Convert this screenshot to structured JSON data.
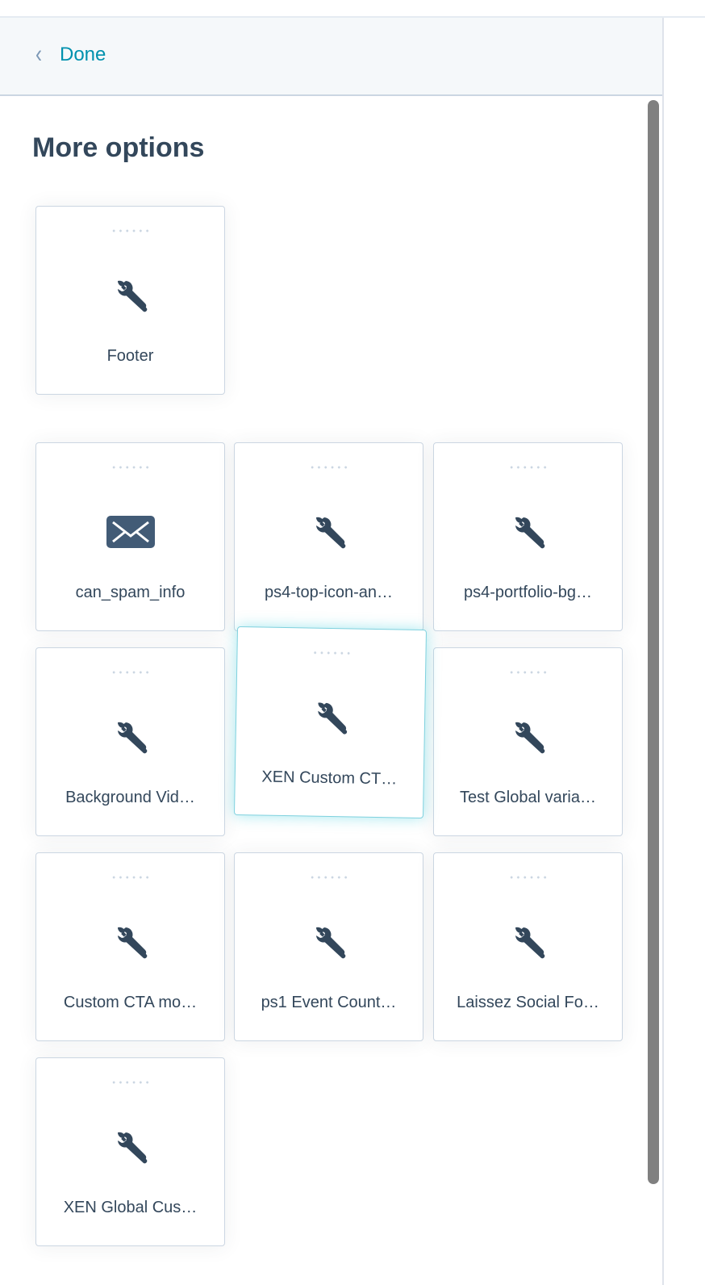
{
  "header": {
    "back_label": "Done",
    "back_icon": "chevron-left-icon"
  },
  "title": "More options",
  "colors": {
    "accent": "#0091ae",
    "text": "#33475b",
    "drag_border": "#7fd1de"
  },
  "featured": [
    {
      "label": "Footer",
      "icon": "tools-icon"
    }
  ],
  "modules": [
    {
      "label": "can_spam_info",
      "icon": "envelope-icon"
    },
    {
      "label": "ps4-top-icon-an…",
      "icon": "tools-icon"
    },
    {
      "label": "ps4-portfolio-bg…",
      "icon": "tools-icon"
    },
    {
      "label": "Background Vid…",
      "icon": "tools-icon"
    },
    {
      "label": "XEN Custom CT…",
      "icon": "tools-icon",
      "dragging": true
    },
    {
      "label": "Test Global varia…",
      "icon": "tools-icon"
    },
    {
      "label": "Custom CTA mo…",
      "icon": "tools-icon"
    },
    {
      "label": "ps1 Event Count…",
      "icon": "tools-icon"
    },
    {
      "label": "Laissez Social Fo…",
      "icon": "tools-icon"
    },
    {
      "label": "XEN Global Cus…",
      "icon": "tools-icon"
    }
  ]
}
